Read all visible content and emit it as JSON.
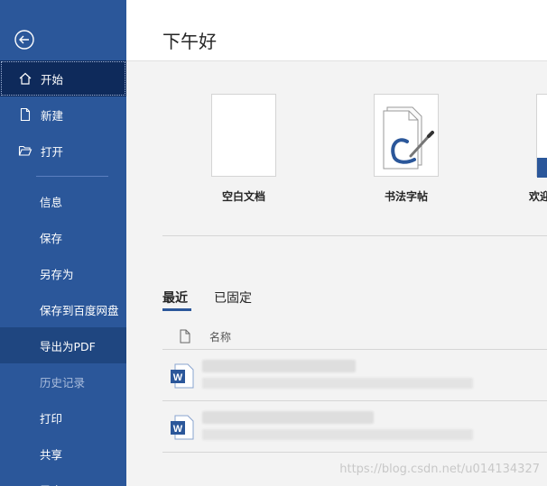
{
  "sidebar": {
    "items": [
      {
        "label": "开始"
      },
      {
        "label": "新建"
      },
      {
        "label": "打开"
      },
      {
        "label": "信息"
      },
      {
        "label": "保存"
      },
      {
        "label": "另存为"
      },
      {
        "label": "保存到百度网盘"
      },
      {
        "label": "导出为PDF"
      },
      {
        "label": "历史记录"
      },
      {
        "label": "打印"
      },
      {
        "label": "共享"
      },
      {
        "label": "导出"
      }
    ]
  },
  "main": {
    "greeting": "下午好",
    "templates": [
      {
        "label": "空白文档"
      },
      {
        "label": "书法字帖"
      },
      {
        "label": "欢迎"
      }
    ],
    "tabs": [
      {
        "label": "最近"
      },
      {
        "label": "已固定"
      }
    ],
    "list_header": {
      "name": "名称"
    }
  },
  "watermark": "https://blog.csdn.net/u014134327",
  "colors": {
    "sidebar": "#2b579a",
    "active": "#0e2a5b",
    "accent": "#2b579a"
  }
}
